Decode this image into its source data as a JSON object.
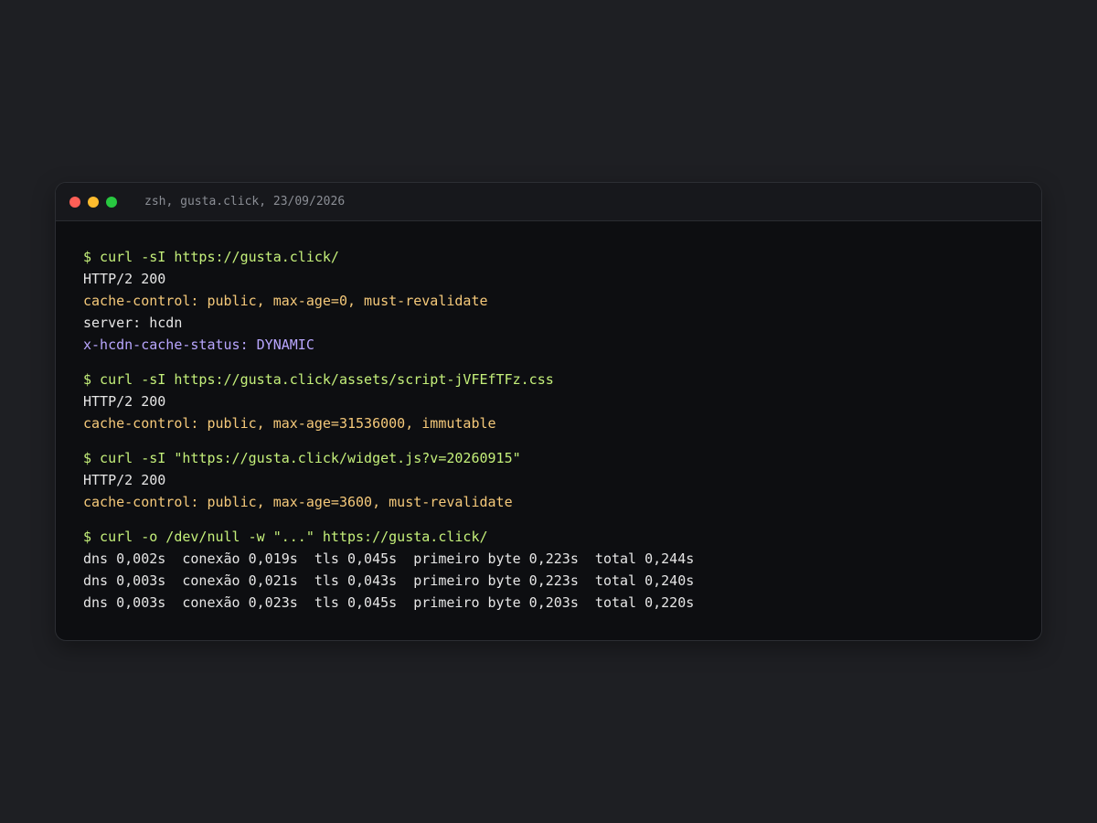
{
  "window": {
    "title": "zsh, gusta.click, 23/09/2026",
    "dots": [
      {
        "name": "close-dot",
        "color": "#ff5f57"
      },
      {
        "name": "minimize-dot",
        "color": "#febc2e"
      },
      {
        "name": "zoom-dot",
        "color": "#28c840"
      }
    ]
  },
  "colors": {
    "command": "#c5f07a",
    "plain": "#e6e6e6",
    "header": "#f5c97a",
    "status": "#b9a6ff"
  },
  "blocks": [
    {
      "lines": [
        {
          "kind": "command",
          "text": "$ curl -sI https://gusta.click/"
        },
        {
          "kind": "plain",
          "text": "HTTP/2 200"
        },
        {
          "kind": "header",
          "text": "cache-control: public, max-age=0, must-revalidate"
        },
        {
          "kind": "plain",
          "text": "server: hcdn"
        },
        {
          "kind": "status",
          "text": "x-hcdn-cache-status: DYNAMIC"
        }
      ]
    },
    {
      "lines": [
        {
          "kind": "command",
          "text": "$ curl -sI https://gusta.click/assets/script-jVFEfTFz.css"
        },
        {
          "kind": "plain",
          "text": "HTTP/2 200"
        },
        {
          "kind": "header",
          "text": "cache-control: public, max-age=31536000, immutable"
        }
      ]
    },
    {
      "lines": [
        {
          "kind": "command",
          "text": "$ curl -sI \"https://gusta.click/widget.js?v=20260915\""
        },
        {
          "kind": "plain",
          "text": "HTTP/2 200"
        },
        {
          "kind": "header",
          "text": "cache-control: public, max-age=3600, must-revalidate"
        }
      ]
    },
    {
      "lines": [
        {
          "kind": "command",
          "text": "$ curl -o /dev/null -w \"...\" https://gusta.click/"
        },
        {
          "kind": "plain",
          "text": "dns 0,002s  conexão 0,019s  tls 0,045s  primeiro byte 0,223s  total 0,244s"
        },
        {
          "kind": "plain",
          "text": "dns 0,003s  conexão 0,021s  tls 0,043s  primeiro byte 0,223s  total 0,240s"
        },
        {
          "kind": "plain",
          "text": "dns 0,003s  conexão 0,023s  tls 0,045s  primeiro byte 0,203s  total 0,220s"
        }
      ]
    }
  ]
}
